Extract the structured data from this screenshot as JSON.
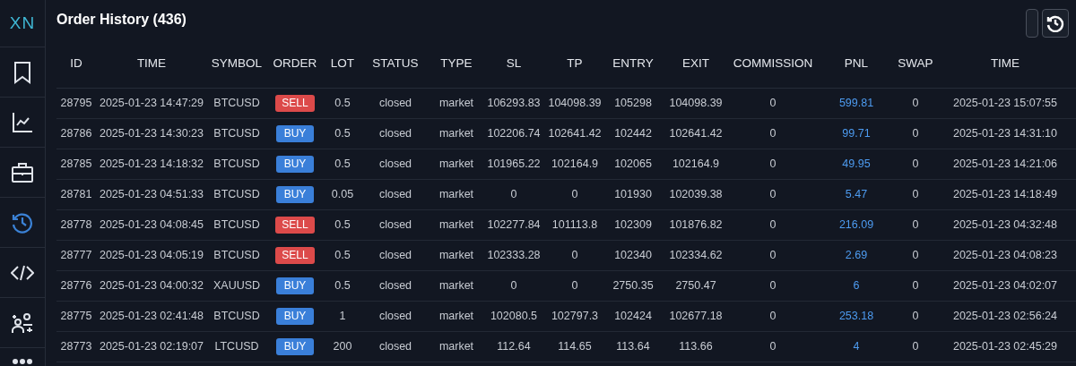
{
  "sidebar": {
    "logo": "XN",
    "items": [
      {
        "kind": "bookmark",
        "selected": false
      },
      {
        "kind": "chart",
        "selected": false
      },
      {
        "kind": "briefcase",
        "selected": false
      },
      {
        "kind": "history",
        "selected": true
      },
      {
        "kind": "code",
        "selected": false
      },
      {
        "kind": "users",
        "selected": false
      },
      {
        "kind": "more",
        "selected": false
      }
    ]
  },
  "header": {
    "title": "Order History (436)"
  },
  "table": {
    "columns": [
      "ID",
      "TIME",
      "SYMBOL",
      "ORDER",
      "LOT",
      "STATUS",
      "TYPE",
      "SL",
      "TP",
      "ENTRY",
      "EXIT",
      "COMMISSION",
      "PNL",
      "SWAP",
      "TIME"
    ],
    "rows": [
      {
        "id": "28795",
        "time": "2025-01-23 14:47:29",
        "symbol": "BTCUSD",
        "order": {
          "label": "SELL",
          "kind": "sell"
        },
        "lot": "0.5",
        "status": "closed",
        "type": "market",
        "sl": "106293.83",
        "tp": "104098.39",
        "entry": "105298",
        "exit": "104098.39",
        "commission": "0",
        "pnl": "599.81",
        "swap": "0",
        "close_time": "2025-01-23 15:07:55"
      },
      {
        "id": "28786",
        "time": "2025-01-23 14:30:23",
        "symbol": "BTCUSD",
        "order": {
          "label": "BUY",
          "kind": "buy"
        },
        "lot": "0.5",
        "status": "closed",
        "type": "market",
        "sl": "102206.74",
        "tp": "102641.42",
        "entry": "102442",
        "exit": "102641.42",
        "commission": "0",
        "pnl": "99.71",
        "swap": "0",
        "close_time": "2025-01-23 14:31:10"
      },
      {
        "id": "28785",
        "time": "2025-01-23 14:18:32",
        "symbol": "BTCUSD",
        "order": {
          "label": "BUY",
          "kind": "buy"
        },
        "lot": "0.5",
        "status": "closed",
        "type": "market",
        "sl": "101965.22",
        "tp": "102164.9",
        "entry": "102065",
        "exit": "102164.9",
        "commission": "0",
        "pnl": "49.95",
        "swap": "0",
        "close_time": "2025-01-23 14:21:06"
      },
      {
        "id": "28781",
        "time": "2025-01-23 04:51:33",
        "symbol": "BTCUSD",
        "order": {
          "label": "BUY",
          "kind": "buy"
        },
        "lot": "0.05",
        "status": "closed",
        "type": "market",
        "sl": "0",
        "tp": "0",
        "entry": "101930",
        "exit": "102039.38",
        "commission": "0",
        "pnl": "5.47",
        "swap": "0",
        "close_time": "2025-01-23 14:18:49"
      },
      {
        "id": "28778",
        "time": "2025-01-23 04:08:45",
        "symbol": "BTCUSD",
        "order": {
          "label": "SELL",
          "kind": "sell"
        },
        "lot": "0.5",
        "status": "closed",
        "type": "market",
        "sl": "102277.84",
        "tp": "101113.8",
        "entry": "102309",
        "exit": "101876.82",
        "commission": "0",
        "pnl": "216.09",
        "swap": "0",
        "close_time": "2025-01-23 04:32:48"
      },
      {
        "id": "28777",
        "time": "2025-01-23 04:05:19",
        "symbol": "BTCUSD",
        "order": {
          "label": "SELL",
          "kind": "sell"
        },
        "lot": "0.5",
        "status": "closed",
        "type": "market",
        "sl": "102333.28",
        "tp": "0",
        "entry": "102340",
        "exit": "102334.62",
        "commission": "0",
        "pnl": "2.69",
        "swap": "0",
        "close_time": "2025-01-23 04:08:23"
      },
      {
        "id": "28776",
        "time": "2025-01-23 04:00:32",
        "symbol": "XAUUSD",
        "order": {
          "label": "BUY",
          "kind": "buy"
        },
        "lot": "0.5",
        "status": "closed",
        "type": "market",
        "sl": "0",
        "tp": "0",
        "entry": "2750.35",
        "exit": "2750.47",
        "commission": "0",
        "pnl": "6",
        "swap": "0",
        "close_time": "2025-01-23 04:02:07"
      },
      {
        "id": "28775",
        "time": "2025-01-23 02:41:48",
        "symbol": "BTCUSD",
        "order": {
          "label": "BUY",
          "kind": "buy"
        },
        "lot": "1",
        "status": "closed",
        "type": "market",
        "sl": "102080.5",
        "tp": "102797.3",
        "entry": "102424",
        "exit": "102677.18",
        "commission": "0",
        "pnl": "253.18",
        "swap": "0",
        "close_time": "2025-01-23 02:56:24"
      },
      {
        "id": "28773",
        "time": "2025-01-23 02:19:07",
        "symbol": "LTCUSD",
        "order": {
          "label": "BUY",
          "kind": "buy"
        },
        "lot": "200",
        "status": "closed",
        "type": "market",
        "sl": "112.64",
        "tp": "114.65",
        "entry": "113.64",
        "exit": "113.66",
        "commission": "0",
        "pnl": "4",
        "swap": "0",
        "close_time": "2025-01-23 02:45:29"
      }
    ]
  }
}
